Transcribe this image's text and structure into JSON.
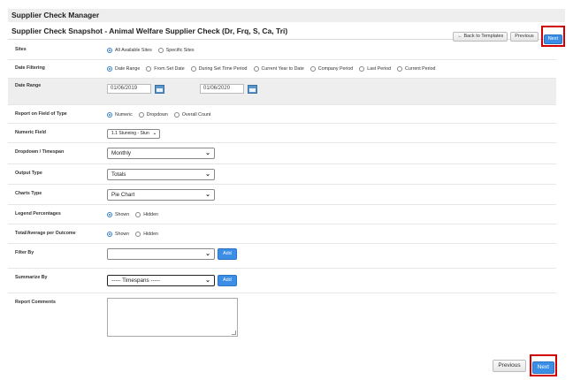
{
  "app_header": "Supplier Check Manager",
  "page_title": "Supplier Check Snapshot - Animal Welfare Supplier Check (Dr, Frq, S, Ca, Tri)",
  "top_buttons": {
    "back": "Back to Templates",
    "previous": "Previous",
    "next": "Next"
  },
  "form": {
    "sites": {
      "label": "Sites",
      "options": [
        "All Available Sites",
        "Specific Sites"
      ],
      "selected": 0
    },
    "date_filtering": {
      "label": "Date Filtering",
      "options": [
        "Date Range",
        "From Set Date",
        "During Set Time Period",
        "Current Year to Date",
        "Company Period",
        "Last Period",
        "Current Period"
      ],
      "selected": 0
    },
    "date_range": {
      "label": "Date Range",
      "from": "01/06/2019",
      "to": "01/06/2020"
    },
    "report_on_field": {
      "label": "Report on Field of Type",
      "options": [
        "Numeric",
        "Dropdown",
        "Overall Count"
      ],
      "selected": 0
    },
    "numeric_field": {
      "label": "Numeric Field",
      "value": "1.1 Stunning - Stun"
    },
    "dropdown_timespan": {
      "label": "Dropdown / Timespan",
      "value": "Monthly"
    },
    "output_type": {
      "label": "Output Type",
      "value": "Totals"
    },
    "charts_type": {
      "label": "Charts Type",
      "value": "Pie Chart"
    },
    "legend_percentages": {
      "label": "Legend Percentages",
      "options": [
        "Shown",
        "Hidden"
      ],
      "selected": 0
    },
    "total_average": {
      "label": "Total/Average per Outcome",
      "options": [
        "Shown",
        "Hidden"
      ],
      "selected": 0
    },
    "filter_by": {
      "label": "Filter By",
      "value": "",
      "add": "Add"
    },
    "summarize_by": {
      "label": "Summarize By",
      "value": "----- Timespans -----",
      "add": "Add"
    },
    "report_comments": {
      "label": "Report Comments",
      "value": ""
    }
  },
  "bottom_buttons": {
    "previous": "Previous",
    "next": "Next"
  },
  "colors": {
    "primary": "#3a8ee6",
    "highlight": "#d00000",
    "shaded_row": "#eeeeee"
  }
}
